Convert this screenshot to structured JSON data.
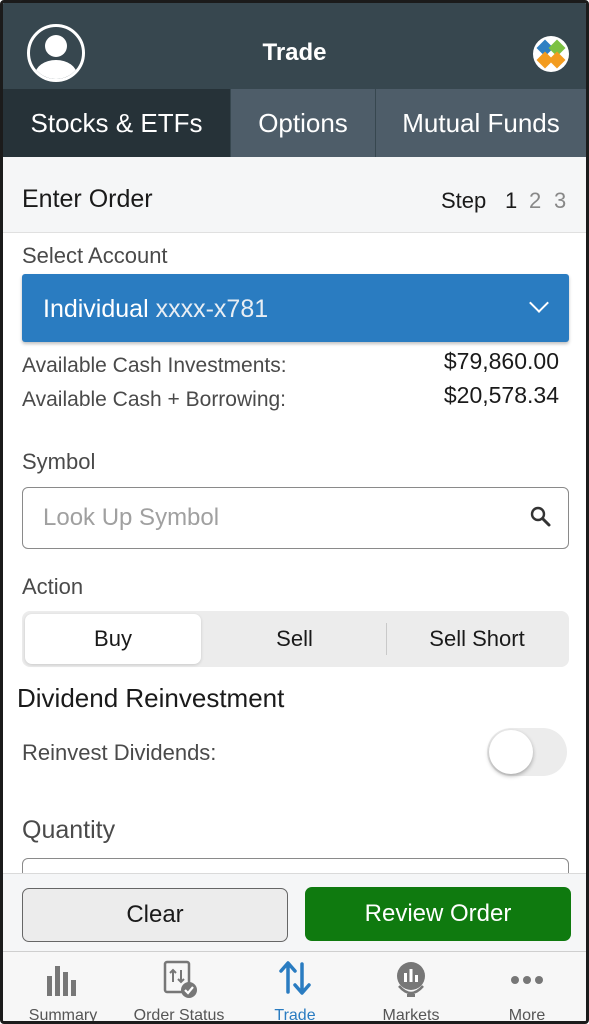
{
  "header": {
    "title": "Trade"
  },
  "tabs": [
    {
      "label": "Stocks & ETFs",
      "active": true
    },
    {
      "label": "Options",
      "active": false
    },
    {
      "label": "Mutual Funds",
      "active": false
    }
  ],
  "order": {
    "title": "Enter Order",
    "step_label": "Step",
    "steps": [
      "1",
      "2",
      "3"
    ],
    "current_step": 1
  },
  "account": {
    "label": "Select Account",
    "name": "Individual",
    "number": "xxxx-x781"
  },
  "cash": {
    "investments_label": "Available Cash Investments:",
    "investments_value": "$79,860.00",
    "borrowing_label": "Available Cash + Borrowing:",
    "borrowing_value": "$20,578.34"
  },
  "symbol": {
    "label": "Symbol",
    "placeholder": "Look Up Symbol",
    "value": ""
  },
  "action": {
    "label": "Action",
    "options": [
      "Buy",
      "Sell",
      "Sell Short"
    ],
    "selected": "Buy"
  },
  "dividend": {
    "title": "Dividend Reinvestment",
    "reinvest_label": "Reinvest Dividends:",
    "reinvest_on": false
  },
  "quantity": {
    "label": "Quantity"
  },
  "buttons": {
    "clear": "Clear",
    "review": "Review Order"
  },
  "bottom_nav": [
    {
      "label": "Summary",
      "icon": "bar-chart-icon",
      "active": false
    },
    {
      "label": "Order Status",
      "icon": "order-status-icon",
      "active": false
    },
    {
      "label": "Trade",
      "icon": "trade-arrows-icon",
      "active": true
    },
    {
      "label": "Markets",
      "icon": "globe-chart-icon",
      "active": false
    },
    {
      "label": "More",
      "icon": "more-dots-icon",
      "active": false
    }
  ],
  "colors": {
    "header_bg": "#37474f",
    "active_tab_bg": "#263238",
    "account_select_bg": "#2a7cc1",
    "review_button_bg": "#0f7a0f",
    "active_nav": "#2a7cc1"
  }
}
